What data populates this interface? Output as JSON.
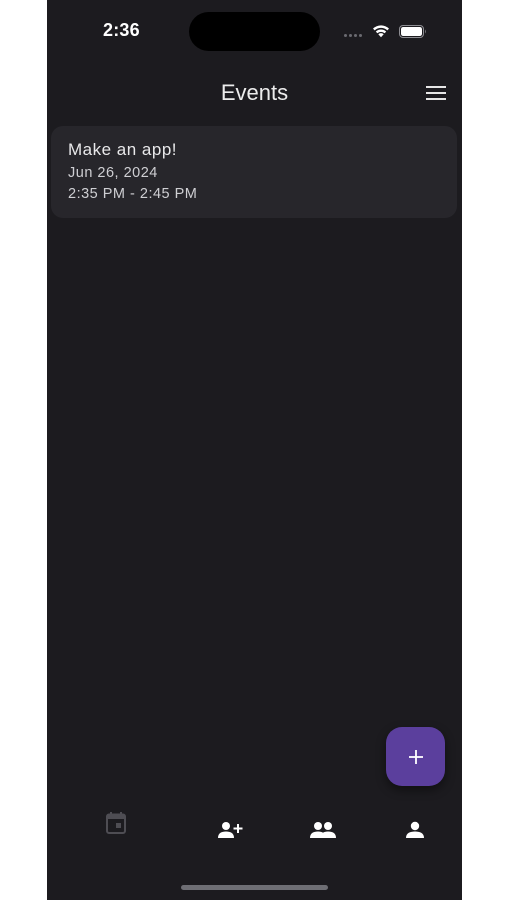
{
  "status_bar": {
    "time": "2:36"
  },
  "app_bar": {
    "title": "Events"
  },
  "events": [
    {
      "title": "Make an app!",
      "date": "Jun 26, 2024",
      "time": "2:35 PM - 2:45 PM"
    }
  ],
  "fab": {
    "icon": "plus-icon",
    "label": "+"
  },
  "bottom_nav": {
    "items": [
      {
        "name": "calendar",
        "icon": "calendar-icon",
        "active": false
      },
      {
        "name": "add-friend",
        "icon": "person-add-icon",
        "active": false
      },
      {
        "name": "groups",
        "icon": "people-icon",
        "active": false
      },
      {
        "name": "profile",
        "icon": "person-icon",
        "active": false
      }
    ]
  },
  "colors": {
    "background": "#1c1b1f",
    "card": "#27262b",
    "accent": "#5b3f9d",
    "text_primary": "#ececec"
  }
}
